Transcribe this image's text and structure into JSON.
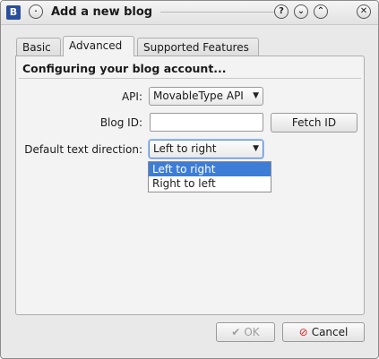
{
  "window": {
    "title": "Add a new blog",
    "app_icon_letter": "B",
    "title_buttons": {
      "help": "?",
      "minimize": "⌄",
      "maximize": "⌃",
      "close": "✕"
    }
  },
  "tabs": [
    {
      "label": "Basic",
      "active": false
    },
    {
      "label": "Advanced",
      "active": true
    },
    {
      "label": "Supported Features",
      "active": false
    }
  ],
  "advanced": {
    "heading": "Configuring your blog account...",
    "api_label": "API:",
    "api_value": "MovableType API",
    "blog_id_label": "Blog ID:",
    "blog_id_value": "",
    "fetch_id_label": "Fetch ID",
    "direction_label": "Default text direction:",
    "direction_value": "Left to right",
    "direction_options": [
      "Left to right",
      "Right to left"
    ],
    "direction_selected_index": 0
  },
  "footer": {
    "ok_label": "OK",
    "ok_enabled": false,
    "cancel_label": "Cancel"
  },
  "colors": {
    "selection": "#3d7dd6",
    "cancel_icon": "#d12a2a"
  }
}
